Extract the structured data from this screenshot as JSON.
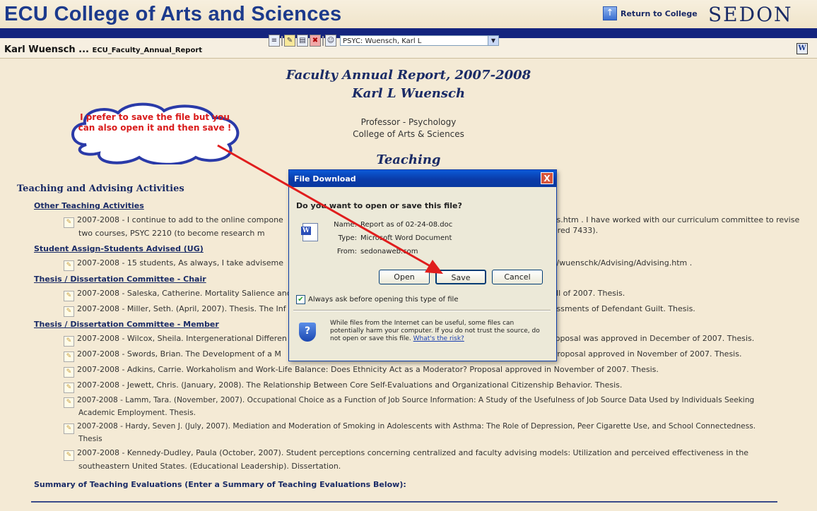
{
  "header": {
    "app_title": "ECU College of Arts and Sciences",
    "return_label": "Return to College",
    "logo_text": "SEDON"
  },
  "subheader": {
    "user_name": "Karl Wuensch ...",
    "report_label": "ECU_Faculty_Annual_Report",
    "person_select": "PSYC: Wuensch, Karl L",
    "word_icon": "W"
  },
  "report": {
    "title": "Faculty Annual Report, 2007-2008",
    "name": "Karl L Wuensch",
    "position": "Professor - Psychology",
    "college": "College of Arts & Sciences",
    "section": "Teaching",
    "heading": "Teaching and Advising Activities",
    "categories": [
      "Other Teaching Activities",
      "Student Assign-Students Advised (UG)",
      "Thesis / Dissertation Committee - Chair",
      "Thesis / Dissertation Committee - Member",
      "Summary of Teaching Evaluations (Enter a Summary of Teaching Evaluations Below):"
    ],
    "entries": [
      "2007-2008 - I continue to add to the online compone",
      "two courses, PSYC 2210 (to become research m",
      "ses.htm . I have worked with our curriculum committee to revise",
      "bered 7433).",
      "2007-2008 - 15 students, As always, I take adviseme",
      "yc/wuenschk/Advising/Advising.htm .",
      "2007-2008 - Saleska, Catherine. Mortality Salience and",
      "Fall of 2007. Thesis.",
      "2007-2008 - Miller, Seth. (April, 2007). Thesis. The Inf",
      "sessments of Defendant Guilt. Thesis.",
      "2007-2008 - Wilcox, Sheila. Intergenerational Differen",
      "Proposal was approved in December of 2007. Thesis.",
      "2007-2008 - Swords, Brian. The Development of a M",
      ". Proposal approved in November of 2007. Thesis.",
      "2007-2008 - Adkins, Carrie. Workaholism and Work-Life Balance: Does Ethnicity Act as a Moderator? Proposal approved in November of 2007. Thesis.",
      "2007-2008 - Jewett, Chris. (January, 2008). The Relationship Between Core Self-Evaluations and Organizational Citizenship Behavior. Thesis.",
      "2007-2008 - Lamm, Tara. (November, 2007). Occupational Choice as a Function of Job Source Information: A Study of the Usefulness of Job Source Data Used by Individuals Seeking",
      "Academic Employment. Thesis.",
      "2007-2008 - Hardy, Seven J. (July, 2007). Mediation and Moderation of Smoking in Adolescents with Asthma: The Role of Depression, Peer Cigarette Use, and School Connectedness.",
      "Thesis",
      "2007-2008 - Kennedy-Dudley, Paula (October, 2007). Student perceptions concerning centralized and faculty advising models: Utilization and perceived effectiveness in the",
      "southeastern United States. (Educational Leadership). Dissertation."
    ]
  },
  "callout": {
    "text": "I prefer to save the file but you can also open it and then save !"
  },
  "dialog": {
    "title": "File Download",
    "close": "X",
    "question": "Do you want to open or save this file?",
    "name_label": "Name:",
    "name_value": "Report as of 02-24-08.doc",
    "type_label": "Type:",
    "type_value": "Microsoft Word Document",
    "from_label": "From:",
    "from_value": "sedonaweb.com",
    "open_label": "Open",
    "save_label": "Save",
    "cancel_label": "Cancel",
    "checkbox_label": "Always ask before opening this type of file",
    "warning": "While files from the Internet can be useful, some files can potentially harm your computer. If you do not trust the source, do not open or save this file.",
    "risk_link": "What's the risk?"
  },
  "colors": {
    "title_blue": "#1c3a8c",
    "header_bar": "#14247e",
    "page_bg": "#f4ead5",
    "callout_text": "#d91b1b",
    "arrow": "#e01d1d",
    "dialog_title": "#0a3ba8"
  },
  "icons": [
    "up-arrow-icon",
    "document-icon",
    "edit-icon",
    "delete-icon",
    "person-icon",
    "word-icon",
    "entry-edit-icon",
    "shield-icon",
    "checkmark-icon"
  ]
}
